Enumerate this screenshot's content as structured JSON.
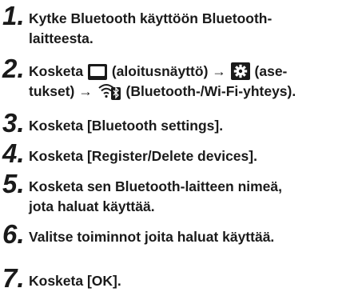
{
  "steps": [
    {
      "number": "1.",
      "line1": "Kytke Bluetooth käyttöön Bluetooth-",
      "line2": "laitteesta."
    },
    {
      "number": "2.",
      "line1_a": "Kosketa",
      "line1_b": "(aloitusnäyttö)",
      "line1_arrow1": "→",
      "line1_c": "(ase-",
      "line2_a": "tukset)",
      "line2_arrow": "→",
      "line2_b": "(Bluetooth-/Wi-Fi-yhteys).",
      "icons": [
        "home-screen-icon",
        "settings-gear-icon",
        "bluetooth-wifi-icon"
      ]
    },
    {
      "number": "3.",
      "line1": "Kosketa [Bluetooth settings]."
    },
    {
      "number": "4.",
      "line1": "Kosketa [Register/Delete devices]."
    },
    {
      "number": "5.",
      "line1": "Kosketa sen Bluetooth-laitteen nimeä,",
      "line2": "jota haluat käyttää."
    },
    {
      "number": "6.",
      "line1": "Valitse toiminnot joita haluat käyttää."
    },
    {
      "number": "7.",
      "line1": "Kosketa [OK]."
    }
  ]
}
